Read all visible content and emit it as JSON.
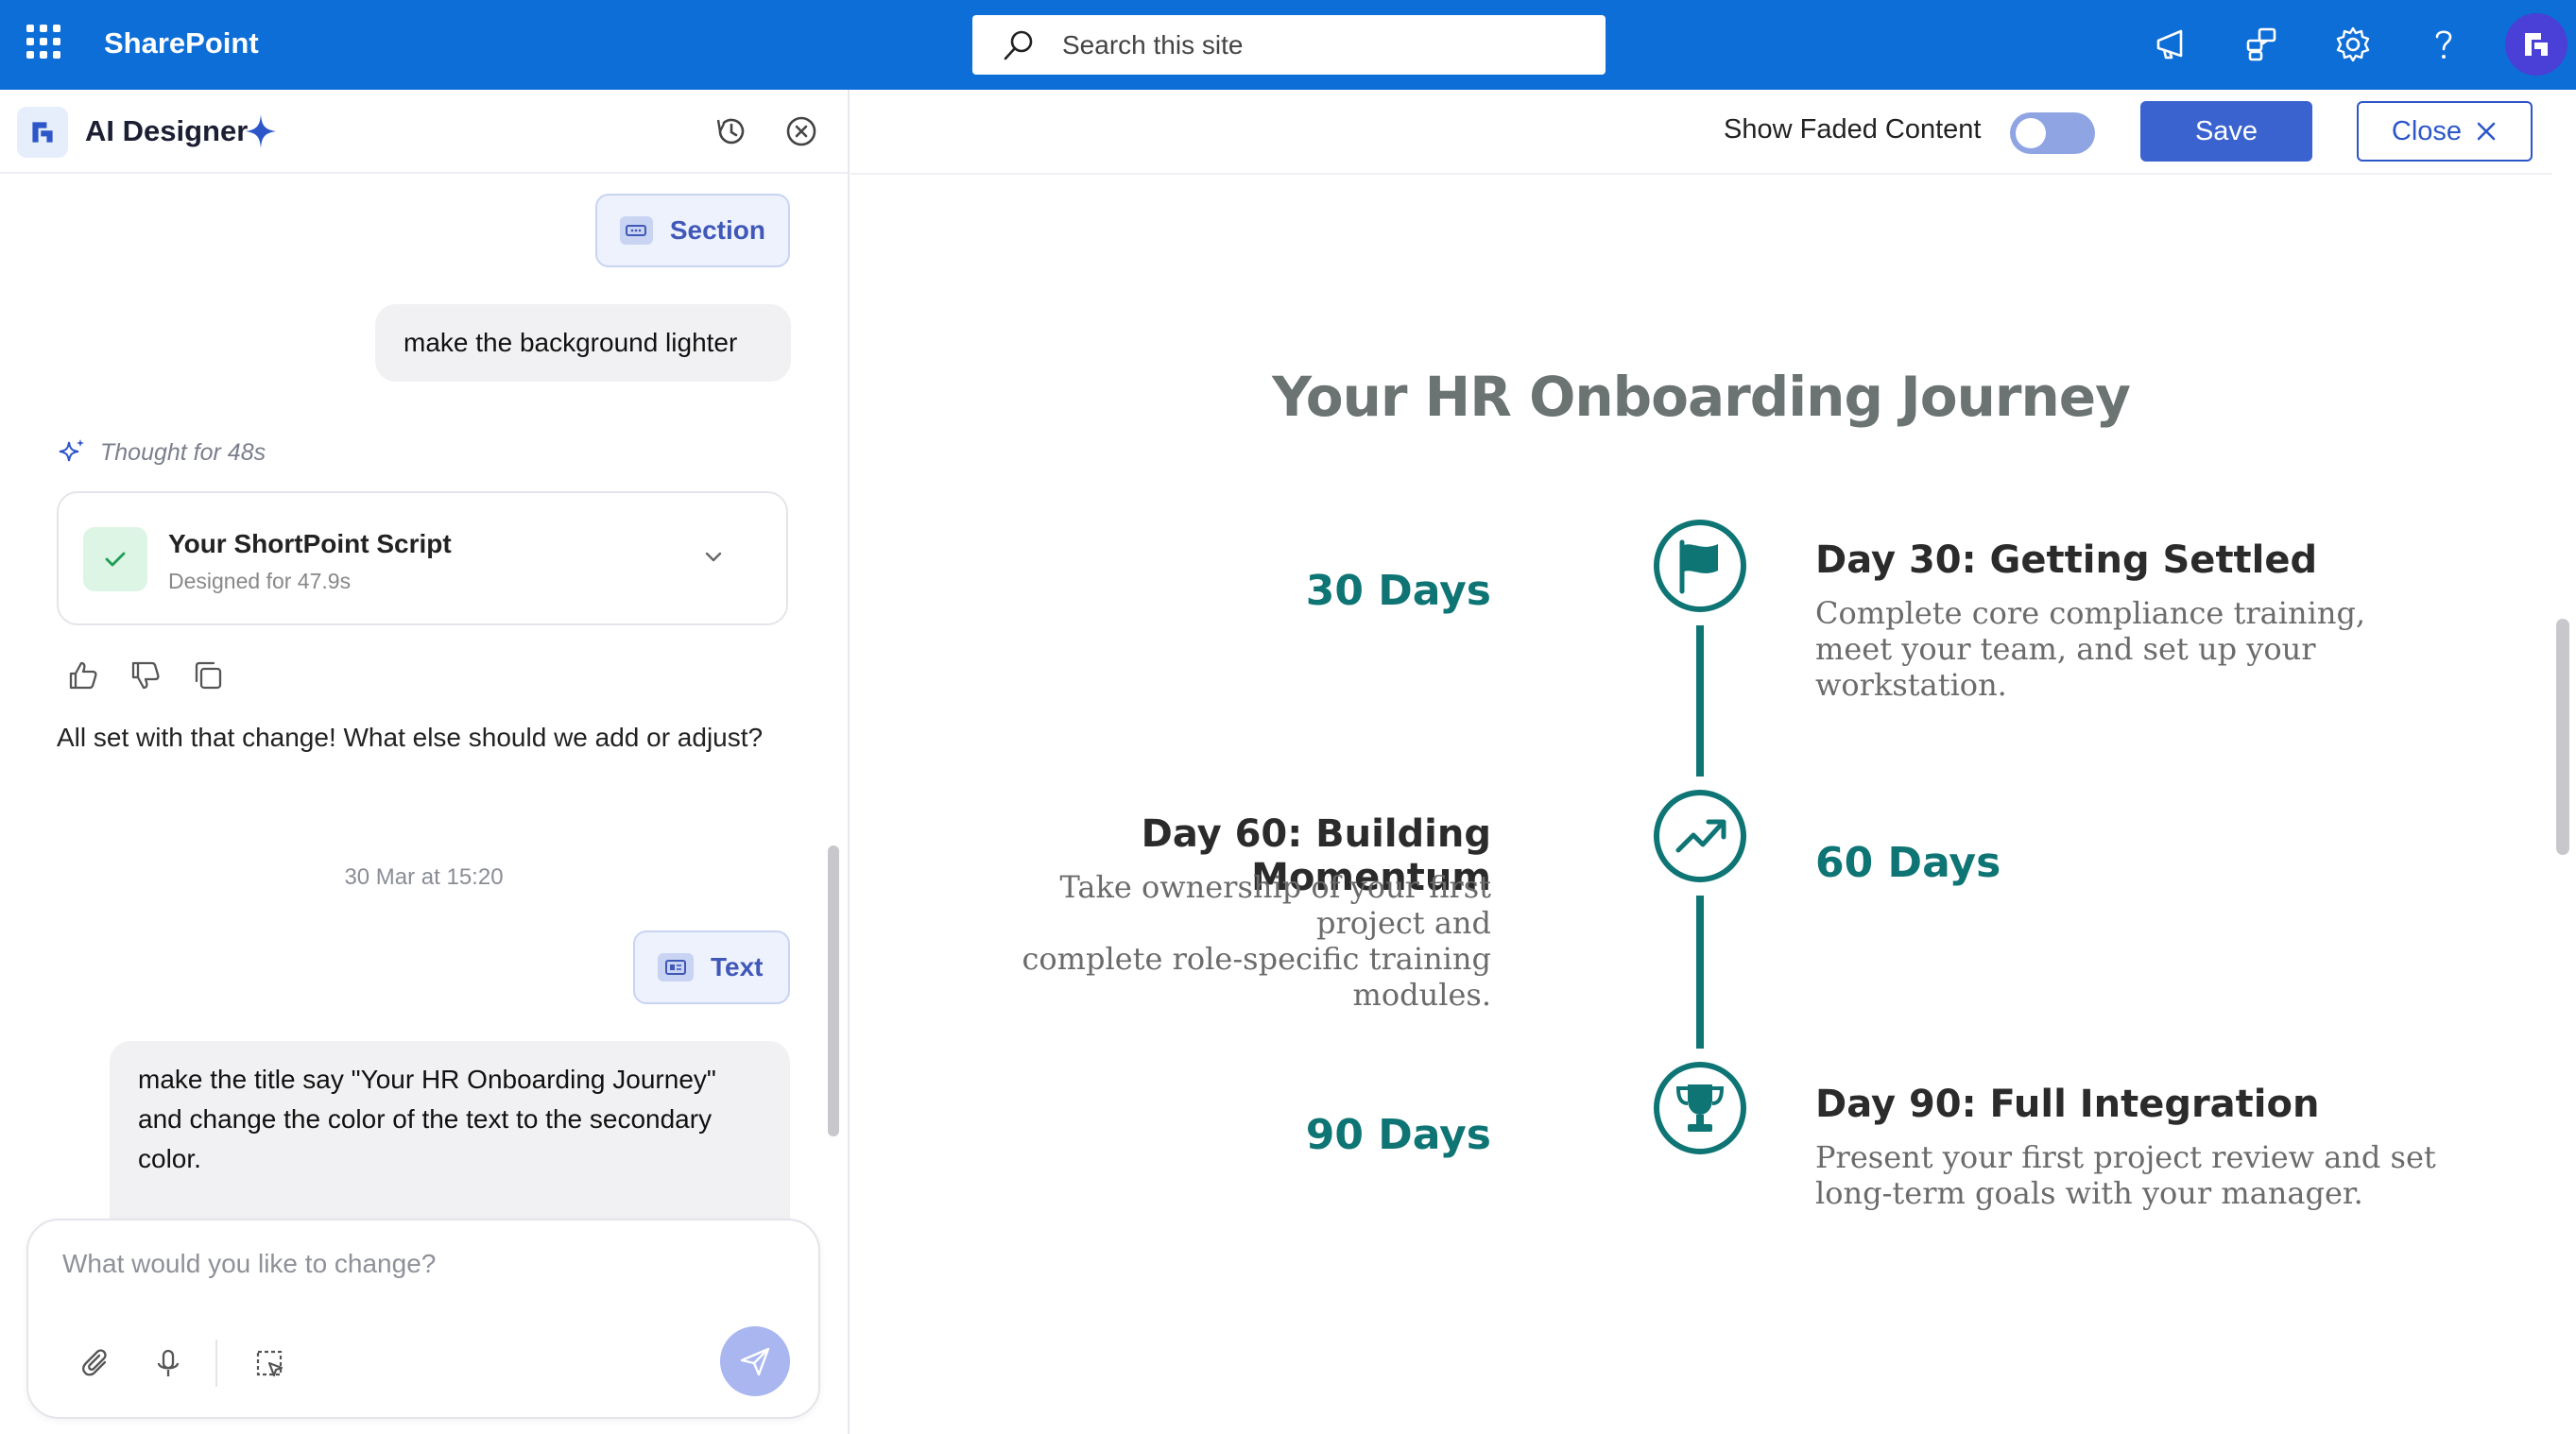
{
  "topbar": {
    "brand": "SharePoint",
    "search_placeholder": "Search this site"
  },
  "left_panel": {
    "title": "AI Designer",
    "messages": {
      "chip_section": "Section",
      "user_msg_1": "make the background lighter",
      "thought": "Thought for 48s",
      "script_title": "Your ShortPoint Script",
      "script_sub": "Designed for 47.9s",
      "assistant_reply": "All set with that change! What else should we add or adjust?",
      "timestamp": "30 Mar at 15:20",
      "chip_text": "Text",
      "user_msg_2": "make the title say \"Your HR Onboarding Journey\" and change the color of the text to the secondary color."
    },
    "composer_placeholder": "What would you like to change?"
  },
  "toolbar": {
    "fade_label": "Show Faded Content",
    "fade_toggle_on": false,
    "save_label": "Save",
    "close_label": "Close"
  },
  "canvas": {
    "title": "Your HR Onboarding Journey",
    "milestones": [
      {
        "days": "30 Days",
        "title": "Day 30: Getting Settled",
        "desc_lines": [
          "Complete core compliance training,",
          "meet your team, and set up your",
          "workstation."
        ],
        "icon": "flag-icon"
      },
      {
        "days": "60 Days",
        "title": "Day 60: Building Momentum",
        "desc_lines": [
          "Take ownership of your first project and",
          "complete role-specific training modules."
        ],
        "icon": "trending-up-icon"
      },
      {
        "days": "90 Days",
        "title": "Day 90: Full Integration",
        "desc_lines": [
          "Present your first project review and set",
          "long-term goals with your manager."
        ],
        "icon": "trophy-icon"
      }
    ],
    "accent_color": "#0e7474"
  },
  "colors": {
    "topbar": "#0d6ed7",
    "primary_button": "#3b63cf",
    "title_text": "#6b7472"
  }
}
